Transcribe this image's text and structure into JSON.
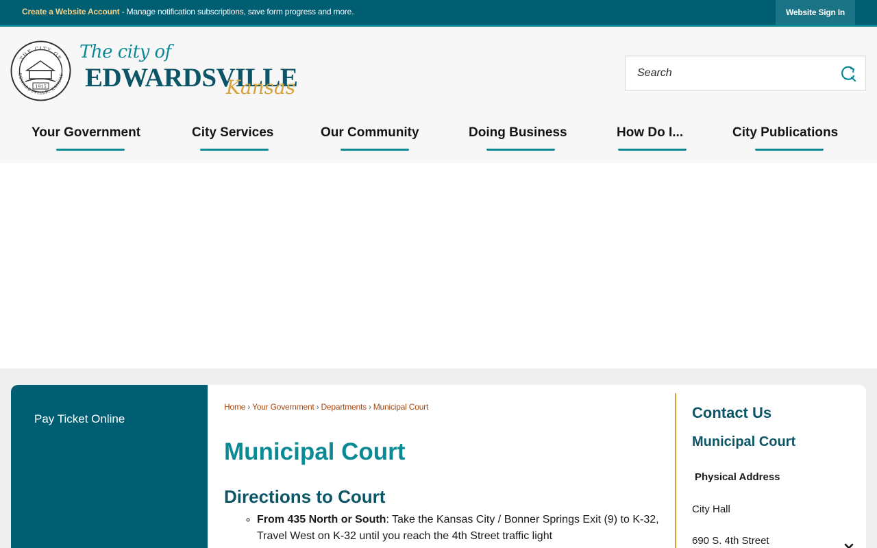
{
  "topbar": {
    "create_account_link": "Create a Website Account",
    "create_account_desc": " - Manage notification subscriptions, save form progress and more.",
    "sign_in_label": "Website Sign In"
  },
  "logo": {
    "the_city_of": "The city of",
    "city_name": "EDWARDSVILLE",
    "state": "Kansas",
    "seal_top_text": "THE CITY OF",
    "seal_bottom_text": "EDWARDSVILLE, KANSAS",
    "seal_year": "1915"
  },
  "search": {
    "placeholder": "Search"
  },
  "nav": {
    "items": [
      {
        "label": "Your Government"
      },
      {
        "label": "City Services"
      },
      {
        "label": "Our Community"
      },
      {
        "label": "Doing Business"
      },
      {
        "label": "How Do I..."
      },
      {
        "label": "City Publications"
      }
    ]
  },
  "sidebar": {
    "items": [
      {
        "label": "Pay Ticket Online"
      }
    ]
  },
  "breadcrumb": {
    "items": [
      "Home",
      "Your Government",
      "Departments",
      "Municipal Court"
    ],
    "separator": "›"
  },
  "main": {
    "page_title": "Municipal Court",
    "section_title": "Directions to Court",
    "directions": [
      {
        "bold": "From 435 North or South",
        "text": ": Take the Kansas City / Bonner Springs Exit (9) to K-32, Travel West on K-32 until you reach the 4th Street traffic light"
      }
    ]
  },
  "contact": {
    "title": "Contact Us",
    "department": "Municipal Court",
    "address_label": "Physical Address",
    "address_line1": "City Hall",
    "address_line2": "690 S. 4th Street"
  },
  "colors": {
    "brand_dark": "#005e72",
    "brand_teal": "#0b8a96",
    "brand_navy": "#0b5566",
    "accent_gold": "#d9a23a",
    "crumb_orange": "#a5460f"
  },
  "icons": {
    "search": "search-icon",
    "close": "close-icon"
  }
}
